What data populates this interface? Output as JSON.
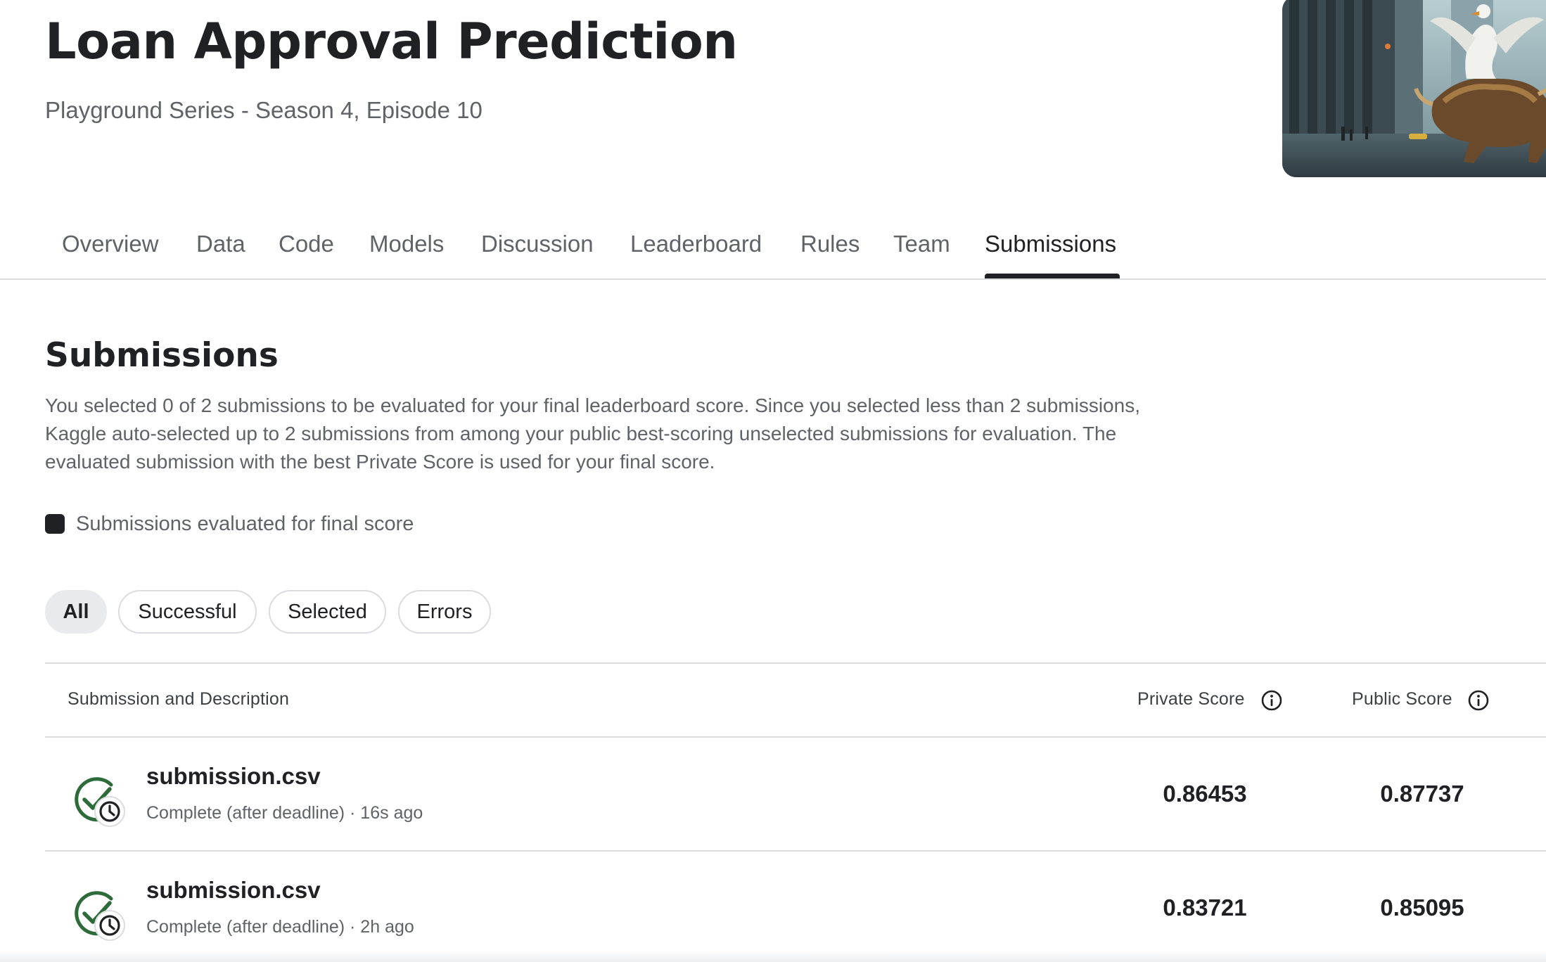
{
  "competition": {
    "title": "Loan Approval Prediction",
    "subtitle": "Playground Series - Season 4, Episode 10"
  },
  "tabs": [
    {
      "label": "Overview"
    },
    {
      "label": "Data"
    },
    {
      "label": "Code"
    },
    {
      "label": "Models"
    },
    {
      "label": "Discussion"
    },
    {
      "label": "Leaderboard"
    },
    {
      "label": "Rules"
    },
    {
      "label": "Team"
    },
    {
      "label": "Submissions",
      "active": true
    }
  ],
  "submissions_section": {
    "title": "Submissions",
    "description": "You selected 0 of 2 submissions to be evaluated for your final leaderboard score. Since you selected less than 2 submissions, Kaggle auto-selected up to 2 submissions from among your public best-scoring unselected submissions for evaluation. The evaluated submission with the best Private Score is used for your final score.",
    "legend_label": "Submissions evaluated for final score"
  },
  "filters": [
    {
      "label": "All",
      "active": true
    },
    {
      "label": "Successful"
    },
    {
      "label": "Selected"
    },
    {
      "label": "Errors"
    }
  ],
  "table": {
    "headers": {
      "submission": "Submission and Description",
      "private": "Private Score",
      "public": "Public Score"
    },
    "rows": [
      {
        "filename": "submission.csv",
        "status": "Complete (after deadline) · 16s ago",
        "private_score": "0.86453",
        "public_score": "0.87737",
        "icon": "check-circle-late-icon"
      },
      {
        "filename": "submission.csv",
        "status": "Complete (after deadline) · 2h ago",
        "private_score": "0.83721",
        "public_score": "0.85095",
        "icon": "check-circle-late-icon"
      }
    ]
  },
  "colors": {
    "success_green": "#2e6b3a",
    "active_tab": "#202124",
    "muted_text": "#5f6368"
  }
}
